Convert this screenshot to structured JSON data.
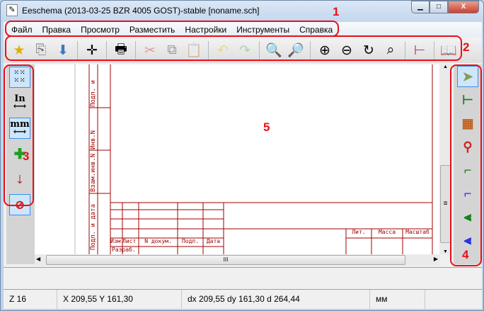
{
  "window": {
    "title": "Eeschema (2013-03-25 BZR 4005 GOST)-stable [noname.sch]",
    "minimize": "▁",
    "maximize": "□",
    "close": "X"
  },
  "menu": [
    "Файл",
    "Правка",
    "Просмотр",
    "Разместить",
    "Настройки",
    "Инструменты",
    "Справка"
  ],
  "toolbar": [
    "new-schematic",
    "open-schematic",
    "save",
    "page-settings",
    "print",
    "cut",
    "copy",
    "paste",
    "undo",
    "redo",
    "find",
    "find-replace",
    "zoom-in",
    "zoom-out",
    "redraw",
    "zoom-fit",
    "hierarchy-navigator",
    "library-editor"
  ],
  "left_toolbar": {
    "grid": "grid",
    "inches": "In",
    "mm": "mm",
    "cursor": "cursor",
    "hidden_pins": "pins",
    "bus_wire": "bus-wire"
  },
  "right_toolbar": [
    "select",
    "hierarchy-push",
    "component",
    "power-port",
    "wire",
    "bus",
    "wire-bus-entry",
    "bus-bus-entry"
  ],
  "sheet": {
    "side_labels": [
      "Подп. и дата",
      "Инв.N дубл.",
      "Взам.инв.N",
      "Подп. и дата"
    ],
    "title_headers": [
      "Изм.",
      "Лист",
      "N докум.",
      "Подп.",
      "Дата"
    ],
    "developer": "Разраб.",
    "right_headers": [
      "Лит.",
      "Масса",
      "Масштаб"
    ]
  },
  "status": {
    "zoom": "Z 16",
    "cursor": "X 209,55  Y 161,30",
    "delta": "dx 209,55  dy 161,30  d 264,44",
    "units": "мм"
  },
  "annotations": [
    "1",
    "2",
    "3",
    "4",
    "5"
  ],
  "scroll": {
    "hgrip": "III",
    "vgrip": "≡"
  }
}
